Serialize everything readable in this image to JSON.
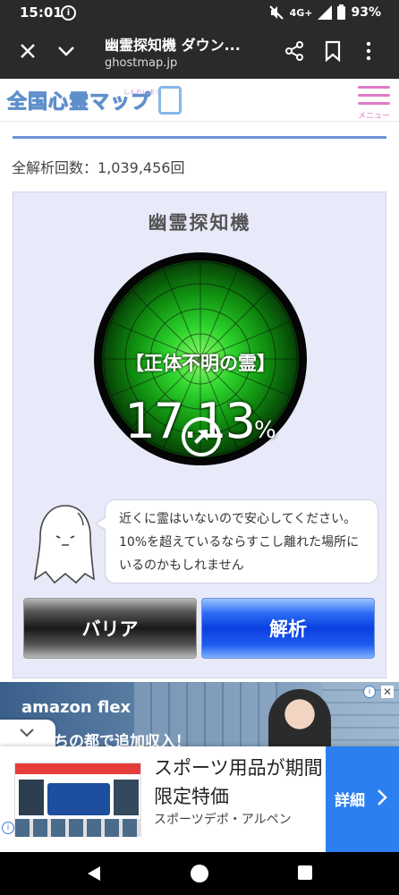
{
  "status_bar": {
    "time": "15:01",
    "network": "4G+",
    "battery": "93%"
  },
  "browser": {
    "page_title": "幽霊探知機 ダウン...",
    "url": "ghostmap.jp"
  },
  "site": {
    "logo_text": "全国心霊マップ",
    "logo_sub": "しんれいまっぷ",
    "menu_label": "メニュー"
  },
  "stats": {
    "label": "全解析回数：",
    "count": "1,039,456",
    "unit": "回"
  },
  "detector": {
    "title": "幽霊探知機",
    "spirit_label": "【正体不明の霊】",
    "percent_value": "17.13",
    "percent_unit": "%",
    "message": "近くに霊はいないので安心してください。10%を超えているならすこし離れた場所にいるのかもしれません",
    "barrier_button": "バリア",
    "analyze_button": "解析"
  },
  "ad_banner": {
    "brand": "amazon flex",
    "overlay_text": "ちの都で追加収入！"
  },
  "bottom_ad": {
    "headline": "スポーツ用品が期間限定特価",
    "advertiser": "スポーツデポ・アルペン",
    "detail_button": "詳細"
  },
  "colors": {
    "accent_blue": "#2b6cf5",
    "radar_green": "#1fae1f",
    "menu_pink": "#e07ac9"
  }
}
